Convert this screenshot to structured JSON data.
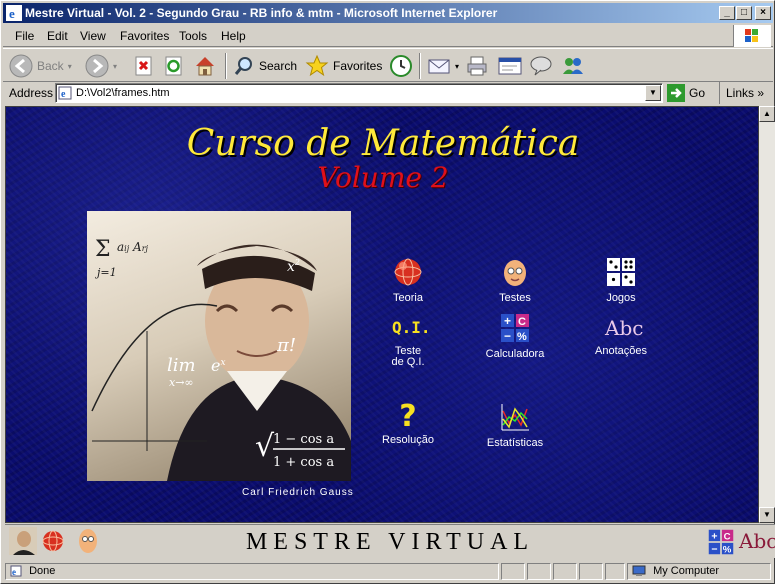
{
  "window": {
    "title": "Mestre Virtual - Vol. 2 - Segundo Grau - RB info & mtm - Microsoft Internet Explorer",
    "minimize": "_",
    "maximize": "□",
    "close": "×"
  },
  "menu": {
    "file": "File",
    "edit": "Edit",
    "view": "View",
    "favorites": "Favorites",
    "tools": "Tools",
    "help": "Help"
  },
  "toolbar": {
    "back": "Back",
    "search": "Search",
    "favorites": "Favorites"
  },
  "address": {
    "label": "Address",
    "value": "D:\\Vol2\\frames.htm",
    "go": "Go",
    "links": "Links"
  },
  "page": {
    "title": "Curso de Matemática",
    "subtitle": "Volume 2",
    "portrait_caption": "Carl Friedrich Gauss",
    "icons": [
      {
        "label": "Teoria",
        "icon": "sphere-icon"
      },
      {
        "label": "Testes",
        "icon": "face-icon"
      },
      {
        "label": "Jogos",
        "icon": "dice-icon"
      },
      {
        "label": "Teste de Q.I.",
        "icon": "qi-icon"
      },
      {
        "label": "Calculadora",
        "icon": "calculator-icon"
      },
      {
        "label": "Anotações",
        "icon": "abc-icon"
      },
      {
        "label": "Resolução",
        "icon": "question-icon"
      },
      {
        "label": "Estatísticas",
        "icon": "chart-icon"
      }
    ],
    "qi_text": "Q.I.",
    "abc_text": "Abc"
  },
  "bottom": {
    "brand": "MESTRE VIRTUAL",
    "abc": "Abc"
  },
  "status": {
    "text": "Done",
    "zone": "My Computer"
  }
}
